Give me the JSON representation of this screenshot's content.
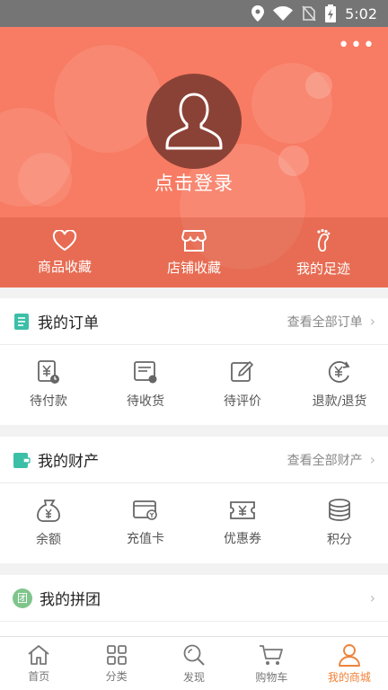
{
  "status_bar": {
    "time": "5:02",
    "icons": [
      "location-icon",
      "wifi-icon",
      "no-sim-icon",
      "battery-icon"
    ]
  },
  "header": {
    "more_label": "•••",
    "login_label": "点击登录",
    "favorites": [
      {
        "label": "商品收藏",
        "icon": "heart-icon"
      },
      {
        "label": "店铺收藏",
        "icon": "store-icon"
      },
      {
        "label": "我的足迹",
        "icon": "footprint-icon"
      }
    ]
  },
  "orders": {
    "title": "我的订单",
    "view_all": "查看全部订单",
    "items": [
      {
        "label": "待付款",
        "icon": "pending-payment-icon"
      },
      {
        "label": "待收货",
        "icon": "pending-receipt-icon"
      },
      {
        "label": "待评价",
        "icon": "pending-review-icon"
      },
      {
        "label": "退款/退货",
        "icon": "refund-icon"
      }
    ]
  },
  "assets": {
    "title": "我的财产",
    "view_all": "查看全部财产",
    "items": [
      {
        "label": "余额",
        "icon": "balance-icon"
      },
      {
        "label": "充值卡",
        "icon": "recharge-card-icon"
      },
      {
        "label": "优惠券",
        "icon": "coupon-icon"
      },
      {
        "label": "积分",
        "icon": "points-icon"
      }
    ]
  },
  "group_buy": {
    "title": "我的拼团",
    "badge": "团"
  },
  "tabs": [
    {
      "label": "首页",
      "icon": "home-icon"
    },
    {
      "label": "分类",
      "icon": "category-icon"
    },
    {
      "label": "发现",
      "icon": "discover-icon"
    },
    {
      "label": "购物车",
      "icon": "cart-icon"
    },
    {
      "label": "我的商城",
      "icon": "profile-icon",
      "active": true
    }
  ],
  "colors": {
    "header": "#f87b63",
    "accent": "#f0823a",
    "orders_icon": "#3cbfa7",
    "group_icon": "#7fc58b"
  }
}
